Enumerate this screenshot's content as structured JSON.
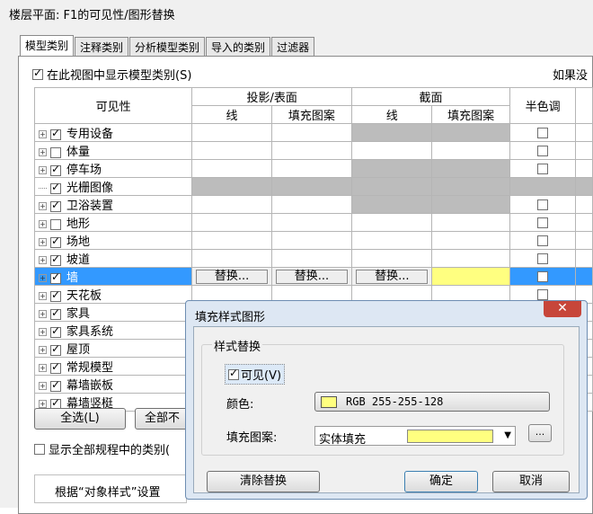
{
  "window": {
    "title": "楼层平面: F1的可见性/图形替换"
  },
  "tabs": [
    "模型类别",
    "注释类别",
    "分析模型类别",
    "导入的类别",
    "过滤器"
  ],
  "show_model": {
    "label": "在此视图中显示模型类别(S)",
    "checked": true
  },
  "truncated_right": "如果没",
  "table": {
    "header_visibility": "可见性",
    "group_projection": "投影/表面",
    "group_cut": "截面",
    "col_line": "线",
    "col_fill": "填充图案",
    "col_halftone": "半色调",
    "override_label": "替换...",
    "rows": [
      {
        "label": "专用设备",
        "checked": true,
        "expand": true,
        "cut_gray": true
      },
      {
        "label": "体量",
        "checked": false,
        "expand": true,
        "cut_gray": false
      },
      {
        "label": "停车场",
        "checked": true,
        "expand": true,
        "cut_gray": true
      },
      {
        "label": "光栅图像",
        "checked": true,
        "expand": false,
        "all_gray": true
      },
      {
        "label": "卫浴装置",
        "checked": true,
        "expand": true,
        "cut_gray": true
      },
      {
        "label": "地形",
        "checked": false,
        "expand": true,
        "cut_gray": false
      },
      {
        "label": "场地",
        "checked": true,
        "expand": true,
        "cut_gray": false
      },
      {
        "label": "坡道",
        "checked": true,
        "expand": true,
        "cut_gray": false
      },
      {
        "label": "墙",
        "checked": true,
        "expand": true,
        "selected": true
      },
      {
        "label": "天花板",
        "checked": true,
        "expand": true
      },
      {
        "label": "家具",
        "checked": true,
        "expand": true
      },
      {
        "label": "家具系统",
        "checked": true,
        "expand": true
      },
      {
        "label": "屋顶",
        "checked": true,
        "expand": true
      },
      {
        "label": "常规模型",
        "checked": true,
        "expand": true
      },
      {
        "label": "幕墙嵌板",
        "checked": true,
        "expand": true
      },
      {
        "label": "幕墙竖梃",
        "checked": true,
        "expand": true
      }
    ]
  },
  "buttons": {
    "select_all": "全选(L)",
    "select_none_partial": "全部不"
  },
  "show_all_disciplines": {
    "label": "显示全部规程中的类别(",
    "checked": false
  },
  "object_style_text": "根据“对象样式”设置",
  "dialog": {
    "title": "填充样式图形",
    "group_label": "样式替换",
    "visible_label": "可见(V)",
    "visible_checked": true,
    "color_label": "颜色:",
    "color_value": "RGB 255-255-128",
    "color_hex": "#ffff80",
    "pattern_label": "填充图案:",
    "pattern_value": "实体填充",
    "browse_label": "...",
    "clear_button": "清除替换",
    "ok_button": "确定",
    "cancel_button": "取消",
    "close_symbol": "✕"
  }
}
